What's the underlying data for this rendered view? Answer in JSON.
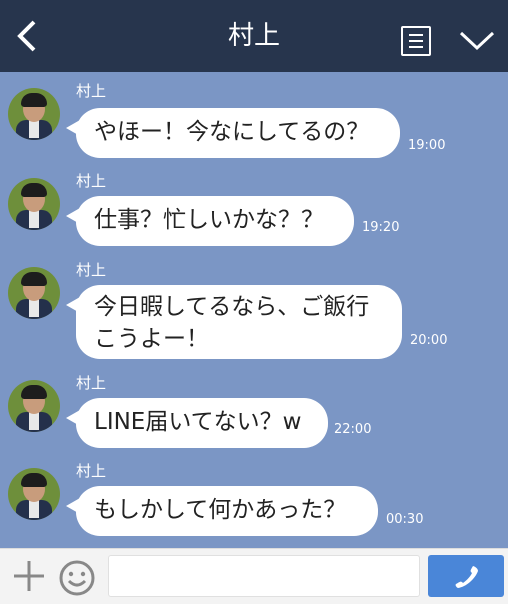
{
  "header": {
    "title": "村上",
    "back_icon": "chevron-left-icon",
    "menu_icon": "list-icon",
    "dropdown_icon": "chevron-down-icon"
  },
  "messages": [
    {
      "sender": "村上",
      "text": "やほー！今なにしてるの？",
      "time": "19:00"
    },
    {
      "sender": "村上",
      "text": "仕事？忙しいかな？？",
      "time": "19:20"
    },
    {
      "sender": "村上",
      "line1": "今日暇してるなら、ご飯行",
      "line2": "こうよー！",
      "time": "20:00"
    },
    {
      "sender": "村上",
      "text": "LINE届いてない？w",
      "time": "22:00"
    },
    {
      "sender": "村上",
      "text": "もしかして何かあった？",
      "time": "00:30"
    }
  ],
  "footer": {
    "input_value": "",
    "plus_icon": "plus-icon",
    "emoji_icon": "smiley-icon",
    "call_icon": "phone-icon",
    "accent": "#4a86d8"
  },
  "colors": {
    "header_bg": "#27354d",
    "chat_bg": "#7b96c5"
  }
}
